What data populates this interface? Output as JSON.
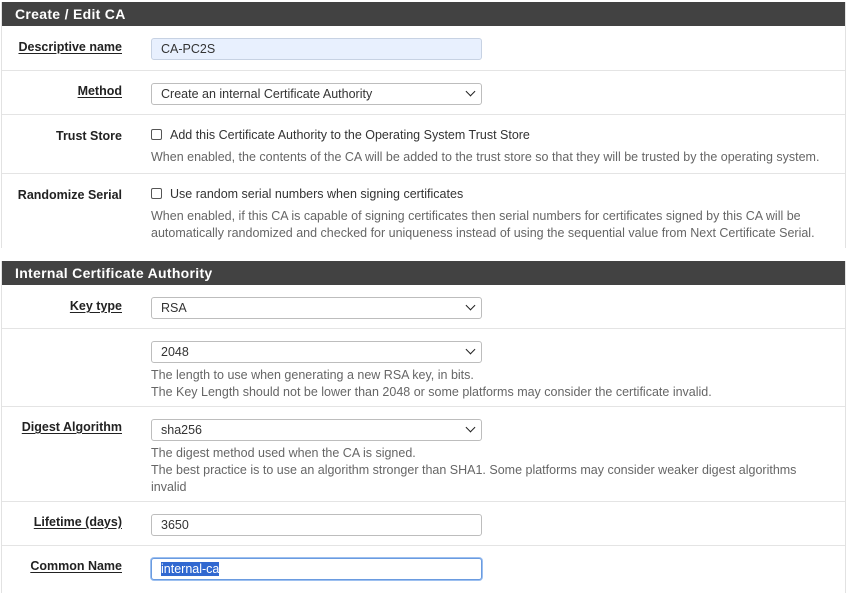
{
  "section1": {
    "heading": "Create / Edit CA",
    "descriptive_name": {
      "label": "Descriptive name",
      "value": "CA-PC2S"
    },
    "method": {
      "label": "Method",
      "value": "Create an internal Certificate Authority"
    },
    "trust_store": {
      "label": "Trust Store",
      "checkbox_label": "Add this Certificate Authority to the Operating System Trust Store",
      "help": "When enabled, the contents of the CA will be added to the trust store so that they will be trusted by the operating system."
    },
    "randomize_serial": {
      "label": "Randomize Serial",
      "checkbox_label": "Use random serial numbers when signing certificates",
      "help_line1": "When enabled, if this CA is capable of signing certificates then serial numbers for certificates signed by this CA will be",
      "help_line2": "automatically randomized and checked for uniqueness instead of using the sequential value from Next Certificate Serial."
    }
  },
  "section2": {
    "heading": "Internal Certificate Authority",
    "key_type": {
      "label": "Key type",
      "value": "RSA"
    },
    "key_length": {
      "value": "2048",
      "help_line1": "The length to use when generating a new RSA key, in bits.",
      "help_line2": "The Key Length should not be lower than 2048 or some platforms may consider the certificate invalid."
    },
    "digest": {
      "label": "Digest Algorithm",
      "value": "sha256",
      "help_line1": "The digest method used when the CA is signed.",
      "help_line2": "The best practice is to use an algorithm stronger than SHA1. Some platforms may consider weaker digest algorithms",
      "help_line3": "invalid"
    },
    "lifetime": {
      "label": "Lifetime (days)",
      "value": "3650"
    },
    "common_name": {
      "label": "Common Name",
      "value": "internal-ca"
    }
  }
}
